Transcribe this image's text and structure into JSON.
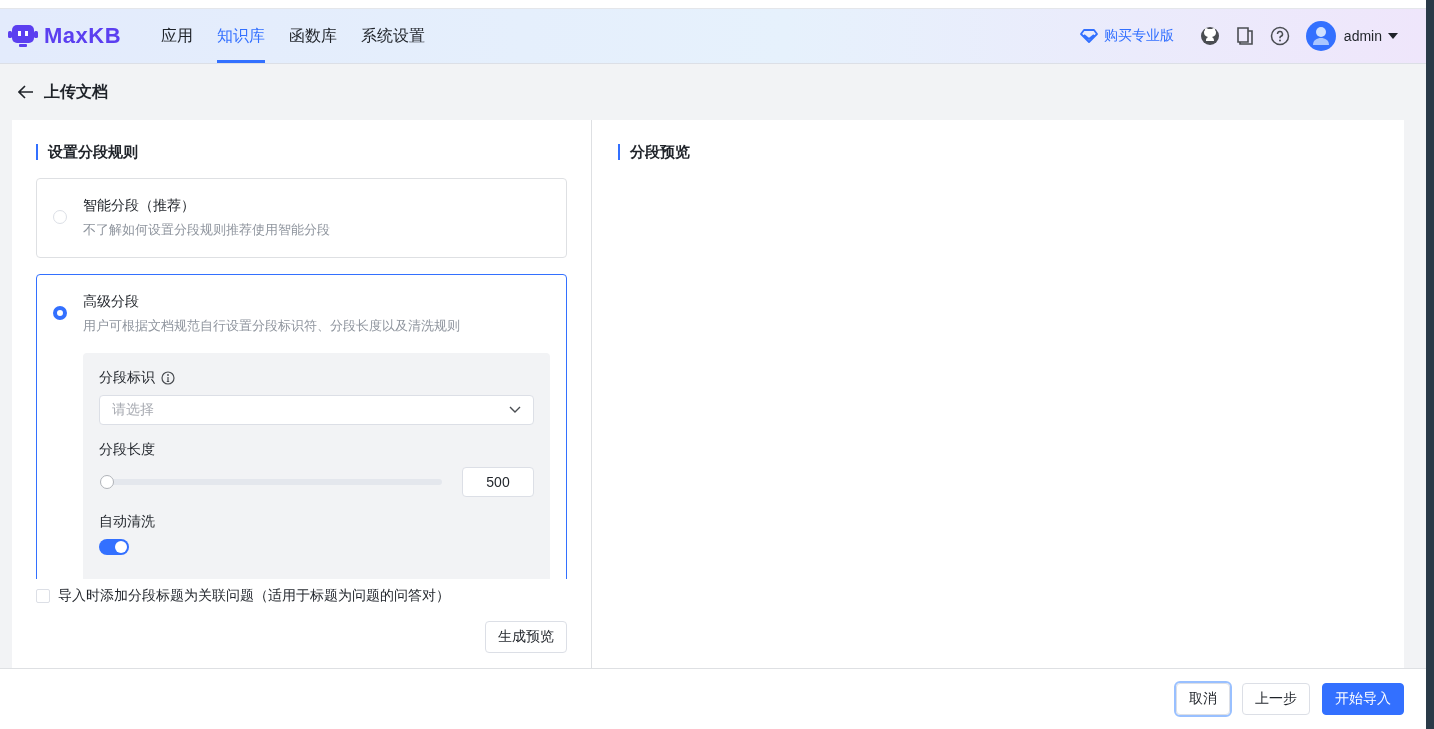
{
  "header": {
    "logo": "MaxKB",
    "nav": [
      {
        "label": "应用",
        "selected": false
      },
      {
        "label": "知识库",
        "selected": true
      },
      {
        "label": "函数库",
        "selected": false
      },
      {
        "label": "系统设置",
        "selected": false
      }
    ],
    "upgrade": "购买专业版",
    "user": "admin"
  },
  "page_title": "上传文档",
  "rules": {
    "title": "设置分段规则",
    "options": [
      {
        "title": "智能分段（推荐）",
        "description": "不了解如何设置分段规则推荐使用智能分段",
        "selected": false
      },
      {
        "title": "高级分段",
        "description": "用户可根据文档规范自行设置分段标识符、分段长度以及清洗规则",
        "selected": true
      }
    ],
    "separator": {
      "label": "分段标识",
      "placeholder": "请选择"
    },
    "length": {
      "label": "分段长度",
      "level": 0,
      "value": "500"
    },
    "auto_clean": {
      "label": "自动清洗",
      "on": true
    },
    "add_title": {
      "label": "导入时添加分段标题为关联问题（适用于标题为问题的问答对）",
      "checked": false
    },
    "preview_button": "生成预览"
  },
  "preview": {
    "title": "分段预览"
  },
  "footer": {
    "buttons": [
      {
        "label": "取消",
        "kind": "focused"
      },
      {
        "label": "上一步",
        "kind": "default"
      },
      {
        "label": "开始导入",
        "kind": "primary"
      }
    ]
  }
}
